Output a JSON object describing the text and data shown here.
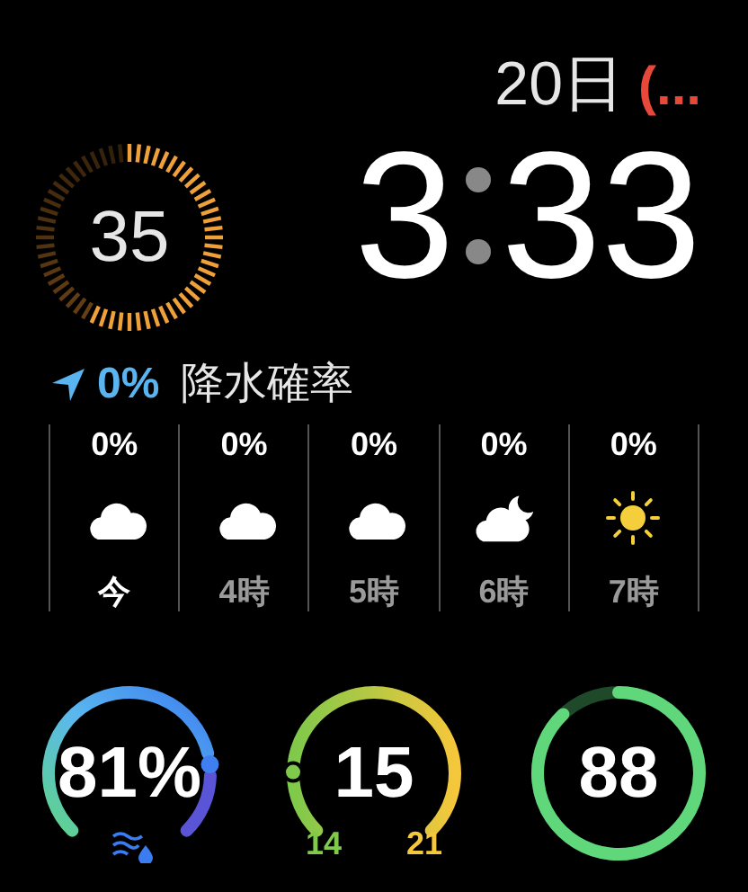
{
  "seconds_ring": {
    "value": "35"
  },
  "date": {
    "day": "20日",
    "indicator": "(..."
  },
  "time": {
    "hour": "3",
    "minute": "33"
  },
  "precipitation": {
    "value": "0%",
    "label": "降水確率"
  },
  "hours": [
    {
      "percent": "0%",
      "kind": "cloud",
      "label": "今",
      "selected": true
    },
    {
      "percent": "0%",
      "kind": "cloud",
      "label": "4時",
      "selected": false
    },
    {
      "percent": "0%",
      "kind": "cloud",
      "label": "5時",
      "selected": false
    },
    {
      "percent": "0%",
      "kind": "cloud_moon",
      "label": "6時",
      "selected": false
    },
    {
      "percent": "0%",
      "kind": "sun",
      "label": "7時",
      "selected": false
    }
  ],
  "gauges": [
    {
      "kind": "humidity",
      "value": "81%"
    },
    {
      "kind": "temperature",
      "value": "15",
      "min": "14",
      "max": "21"
    },
    {
      "kind": "ring",
      "value": "88"
    }
  ]
}
